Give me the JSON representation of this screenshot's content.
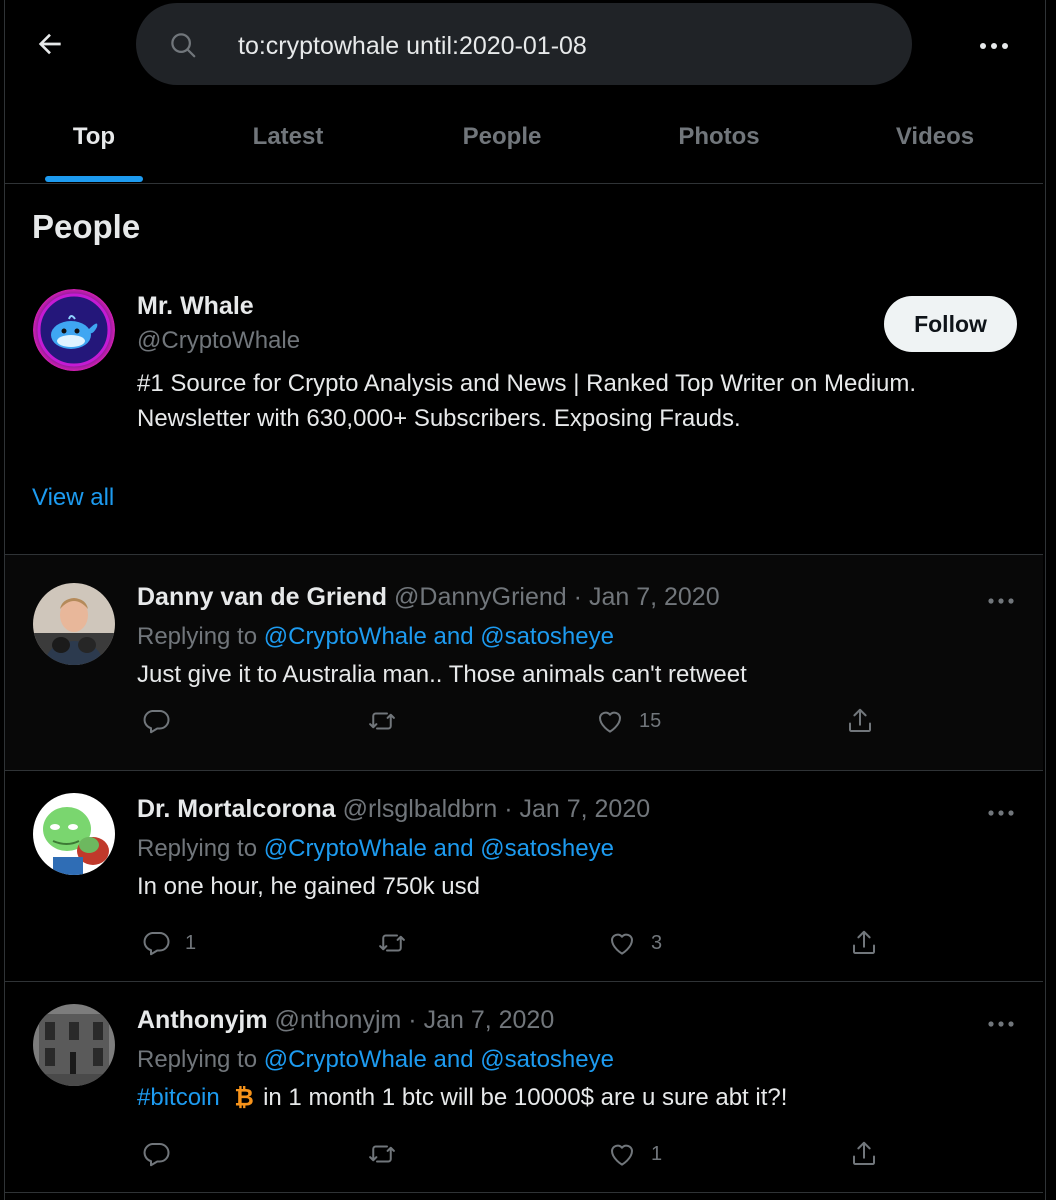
{
  "search": {
    "query": "to:cryptowhale until:2020-01-08"
  },
  "tabs": [
    {
      "label": "Top",
      "active": true
    },
    {
      "label": "Latest",
      "active": false
    },
    {
      "label": "People",
      "active": false
    },
    {
      "label": "Photos",
      "active": false
    },
    {
      "label": "Videos",
      "active": false
    }
  ],
  "people": {
    "title": "People",
    "user": {
      "name": "Mr. Whale",
      "handle": "@CryptoWhale",
      "follow_label": "Follow",
      "bio_line1": "#1 Source for Crypto Analysis and News | Ranked Top Writer on Medium.",
      "bio_line2": "Newsletter with 630,000+ Subscribers. Exposing Frauds."
    },
    "view_all": "View all"
  },
  "tweets": [
    {
      "name": "Danny van de Griend",
      "handle": "@DannyGriend",
      "dot": "·",
      "date": "Jan 7, 2020",
      "replying_prefix": "Replying to ",
      "replying_to": "@CryptoWhale and @satosheye",
      "text": "Just give it to Australia man.. Those animals can't retweet",
      "reply_count": "",
      "retweet_count": "",
      "like_count": "15"
    },
    {
      "name": "Dr. Mortalcorona",
      "handle": "@rlsglbaldbrn",
      "dot": "·",
      "date": "Jan 7, 2020",
      "replying_prefix": "Replying to ",
      "replying_to": "@CryptoWhale and @satosheye",
      "text": "In one hour, he gained 750k usd",
      "reply_count": "1",
      "retweet_count": "",
      "like_count": "3"
    },
    {
      "name": "Anthonyjm",
      "handle": "@nthonyjm",
      "dot": "·",
      "date": "Jan 7, 2020",
      "replying_prefix": "Replying to ",
      "replying_to": "@CryptoWhale and @satosheye",
      "hashtag": "#bitcoin",
      "text": " in 1 month 1 btc will be 10000$ are u sure abt it?!",
      "reply_count": "",
      "retweet_count": "",
      "like_count": "1"
    }
  ],
  "colors": {
    "accent": "#1d9bf0",
    "muted": "#71767b",
    "text": "#e7e9ea",
    "border": "#2f3336",
    "search_bg": "#202327"
  },
  "icons": [
    "back-arrow-icon",
    "search-icon",
    "more-icon",
    "reply-icon",
    "retweet-icon",
    "like-icon",
    "share-icon",
    "bitcoin-icon"
  ]
}
